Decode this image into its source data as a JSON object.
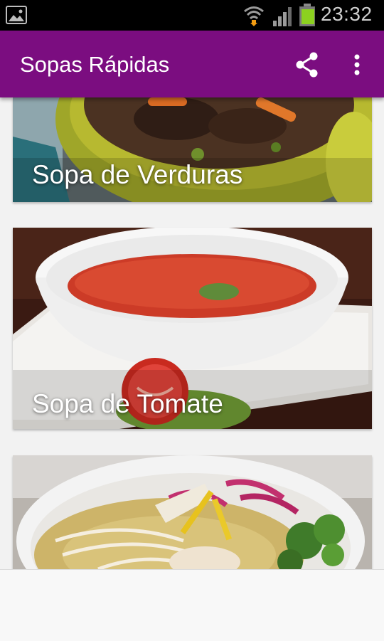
{
  "status_bar": {
    "time": "23:32",
    "icons": [
      "gallery-icon",
      "wifi-icon",
      "signal-icon",
      "battery-icon"
    ]
  },
  "app_bar": {
    "title": "Sopas Rápidas",
    "actions": [
      "share-icon",
      "more-vert-icon"
    ],
    "color": "#7b0d80"
  },
  "recipes": [
    {
      "title": "Sopa de Verduras"
    },
    {
      "title": "Sopa de Tomate"
    },
    {
      "title": ""
    }
  ]
}
